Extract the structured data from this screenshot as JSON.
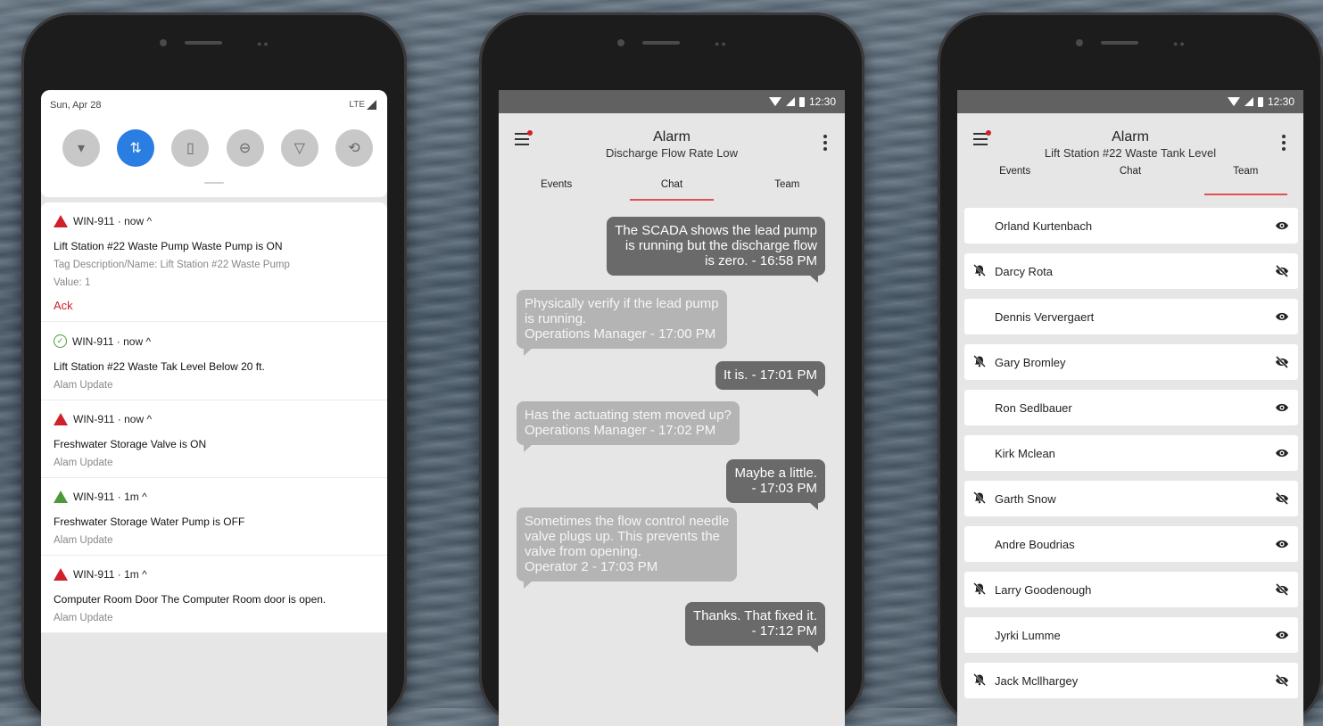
{
  "phone1": {
    "qs": {
      "date": "Sun, Apr 28",
      "network": "LTE",
      "toggles": [
        {
          "icon": "wifi-icon",
          "glyph": "▾",
          "on": false
        },
        {
          "icon": "data-icon",
          "glyph": "⇅",
          "on": true
        },
        {
          "icon": "battery-saver-icon",
          "glyph": "▯",
          "on": false
        },
        {
          "icon": "do-not-disturb-icon",
          "glyph": "⊖",
          "on": false
        },
        {
          "icon": "flashlight-icon",
          "glyph": "▽",
          "on": false
        },
        {
          "icon": "auto-rotate-icon",
          "glyph": "⟲",
          "on": false
        }
      ]
    },
    "notifications": [
      {
        "status": "alarm",
        "app": "WIN-911 · now ^",
        "title": "Lift Station #22 Waste Pump Waste Pump is ON",
        "sub": "Tag Description/Name: Lift Station #22 Waste Pump",
        "sub2": "Value: 1",
        "action": "Ack"
      },
      {
        "status": "ok",
        "app": "WIN-911 · now ^",
        "title": "Lift Station #22 Waste Tak Level Below 20 ft.",
        "sub": "Alam Update"
      },
      {
        "status": "alarm",
        "app": "WIN-911 · now ^",
        "title": "Freshwater Storage Valve is ON",
        "sub": "Alam Update"
      },
      {
        "status": "info",
        "app": "WIN-911 · 1m ^",
        "title": "Freshwater Storage Water Pump is OFF",
        "sub": "Alam Update"
      },
      {
        "status": "alarm",
        "app": "WIN-911 · 1m ^",
        "title": "Computer Room Door The Computer Room door is open.",
        "sub": "Alam Update"
      }
    ]
  },
  "phone2": {
    "status_time": "12:30",
    "title": "Alarm",
    "subtitle": "Discharge Flow Rate Low",
    "tabs": [
      "Events",
      "Chat",
      "Team"
    ],
    "messages": [
      {
        "dir": "out",
        "lines": [
          "The SCADA shows the lead pump",
          "is running but the discharge flow",
          "is zero. - 16:58 PM"
        ]
      },
      {
        "dir": "in",
        "lines": [
          "Physically verify if the lead pump",
          "is running.",
          "Operations Manager - 17:00 PM"
        ]
      },
      {
        "dir": "out",
        "lines": [
          "It is. - 17:01 PM"
        ]
      },
      {
        "dir": "in",
        "lines": [
          "Has the actuating stem moved up?",
          "Operations Manager - 17:02 PM"
        ]
      },
      {
        "dir": "out",
        "lines": [
          "Maybe a little.",
          "- 17:03 PM"
        ]
      },
      {
        "dir": "in",
        "lines": [
          "Sometimes the flow control needle",
          "valve plugs up. This prevents the",
          "valve from opening.",
          "Operator 2 - 17:03 PM"
        ]
      },
      {
        "dir": "out",
        "lines": [
          "Thanks. That fixed it.",
          "- 17:12 PM"
        ]
      }
    ]
  },
  "phone3": {
    "status_time": "12:30",
    "title": "Alarm",
    "subtitle": "Lift Station #22 Waste Tank Level",
    "tabs": [
      "Events",
      "Chat",
      "Team"
    ],
    "members": [
      {
        "name": "Orland Kurtenbach",
        "muted": false
      },
      {
        "name": "Darcy Rota",
        "muted": true
      },
      {
        "name": "Dennis Ververgaert",
        "muted": false
      },
      {
        "name": "Gary Bromley",
        "muted": true
      },
      {
        "name": "Ron Sedlbauer",
        "muted": false
      },
      {
        "name": "Kirk Mclean",
        "muted": false
      },
      {
        "name": "Garth Snow",
        "muted": true
      },
      {
        "name": "Andre Boudrias",
        "muted": false
      },
      {
        "name": "Larry Goodenough",
        "muted": true
      },
      {
        "name": "Jyrki Lumme",
        "muted": false
      },
      {
        "name": "Jack Mcllhargey",
        "muted": true
      }
    ]
  },
  "colors": {
    "accent_red": "#d0202a",
    "data_toggle_blue": "#2a7de1",
    "ok_green": "#4a9a3a",
    "statusbar": "#616161"
  }
}
